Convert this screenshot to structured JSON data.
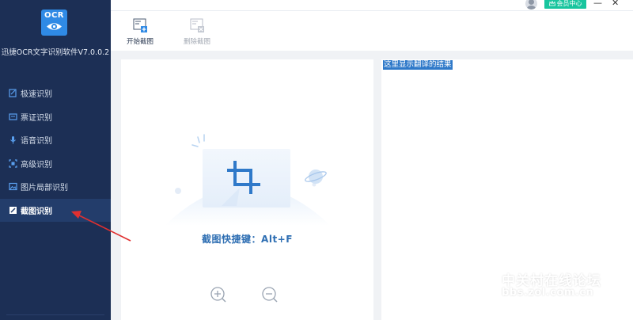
{
  "app": {
    "logo_text": "OCR",
    "title": "迅捷OCR文字识别软件V7.0.0.2"
  },
  "sidebar": {
    "items": [
      {
        "label": "极速识别",
        "icon": "fast-ocr-icon"
      },
      {
        "label": "票证识别",
        "icon": "ticket-icon"
      },
      {
        "label": "语音识别",
        "icon": "microphone-icon"
      },
      {
        "label": "高级识别",
        "icon": "advanced-scan-icon"
      },
      {
        "label": "图片局部识别",
        "icon": "image-icon"
      },
      {
        "label": "截图识别",
        "icon": "screenshot-icon",
        "active": true
      }
    ]
  },
  "titlebar": {
    "vip_label": "会员中心",
    "minimize": "—",
    "close": "✕"
  },
  "toolbar": {
    "start_label": "开始截图",
    "delete_label": "删除截图"
  },
  "left_panel": {
    "hotkey_text": "截图快捷键：Alt+F"
  },
  "right_panel": {
    "result_hint": "这里显示翻译的结果"
  },
  "watermark": {
    "title": "中关村在线论坛",
    "url": "bbs.zol.com.cn"
  },
  "colors": {
    "sidebar_bg": "#1c2f55",
    "sidebar_active": "#233d6b",
    "accent_blue": "#2f8ae5",
    "vip_green": "#18c59e",
    "hotkey_blue": "#2f6fb3",
    "highlight_blue": "#2f79c9",
    "annotation_red": "#e03030"
  }
}
